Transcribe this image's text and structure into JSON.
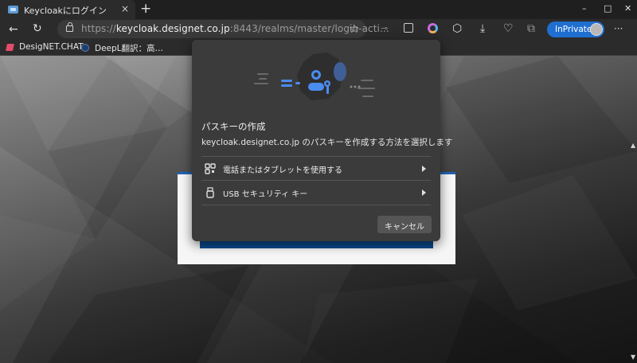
{
  "tab": {
    "title": "Keycloakにログイン",
    "close": "×",
    "new_tab": "+"
  },
  "window_controls": {
    "minimize": "–",
    "maximize": "□",
    "close": "✕"
  },
  "address_bar": {
    "scheme": "https://",
    "host": "keycloak.designet.co.jp",
    "rest": ":8443/realms/master/login-acti..."
  },
  "toolbar": {
    "inprivate_label": "InPrivate",
    "more": "···"
  },
  "bookmarks": [
    {
      "label": "DesigNET.CHAT",
      "icon": "designet-chat-icon"
    },
    {
      "label": "DeepL翻訳：高…",
      "icon": "deepl-icon"
    }
  ],
  "dialog": {
    "title": "パスキーの作成",
    "description": "keycloak.designet.co.jp のパスキーを作成する方法を選択します",
    "options": [
      {
        "label": "電話またはタブレットを使用する",
        "icon": "qr-code-icon"
      },
      {
        "label": "USB セキュリティ キー",
        "icon": "usb-key-icon"
      }
    ],
    "cancel_label": "キャンセル"
  },
  "colors": {
    "accent": "#1f6fd1",
    "dialog_bg": "#3b3b3b",
    "hero_blue": "#4b8cf0",
    "card_bar": "#0b4a8e"
  }
}
